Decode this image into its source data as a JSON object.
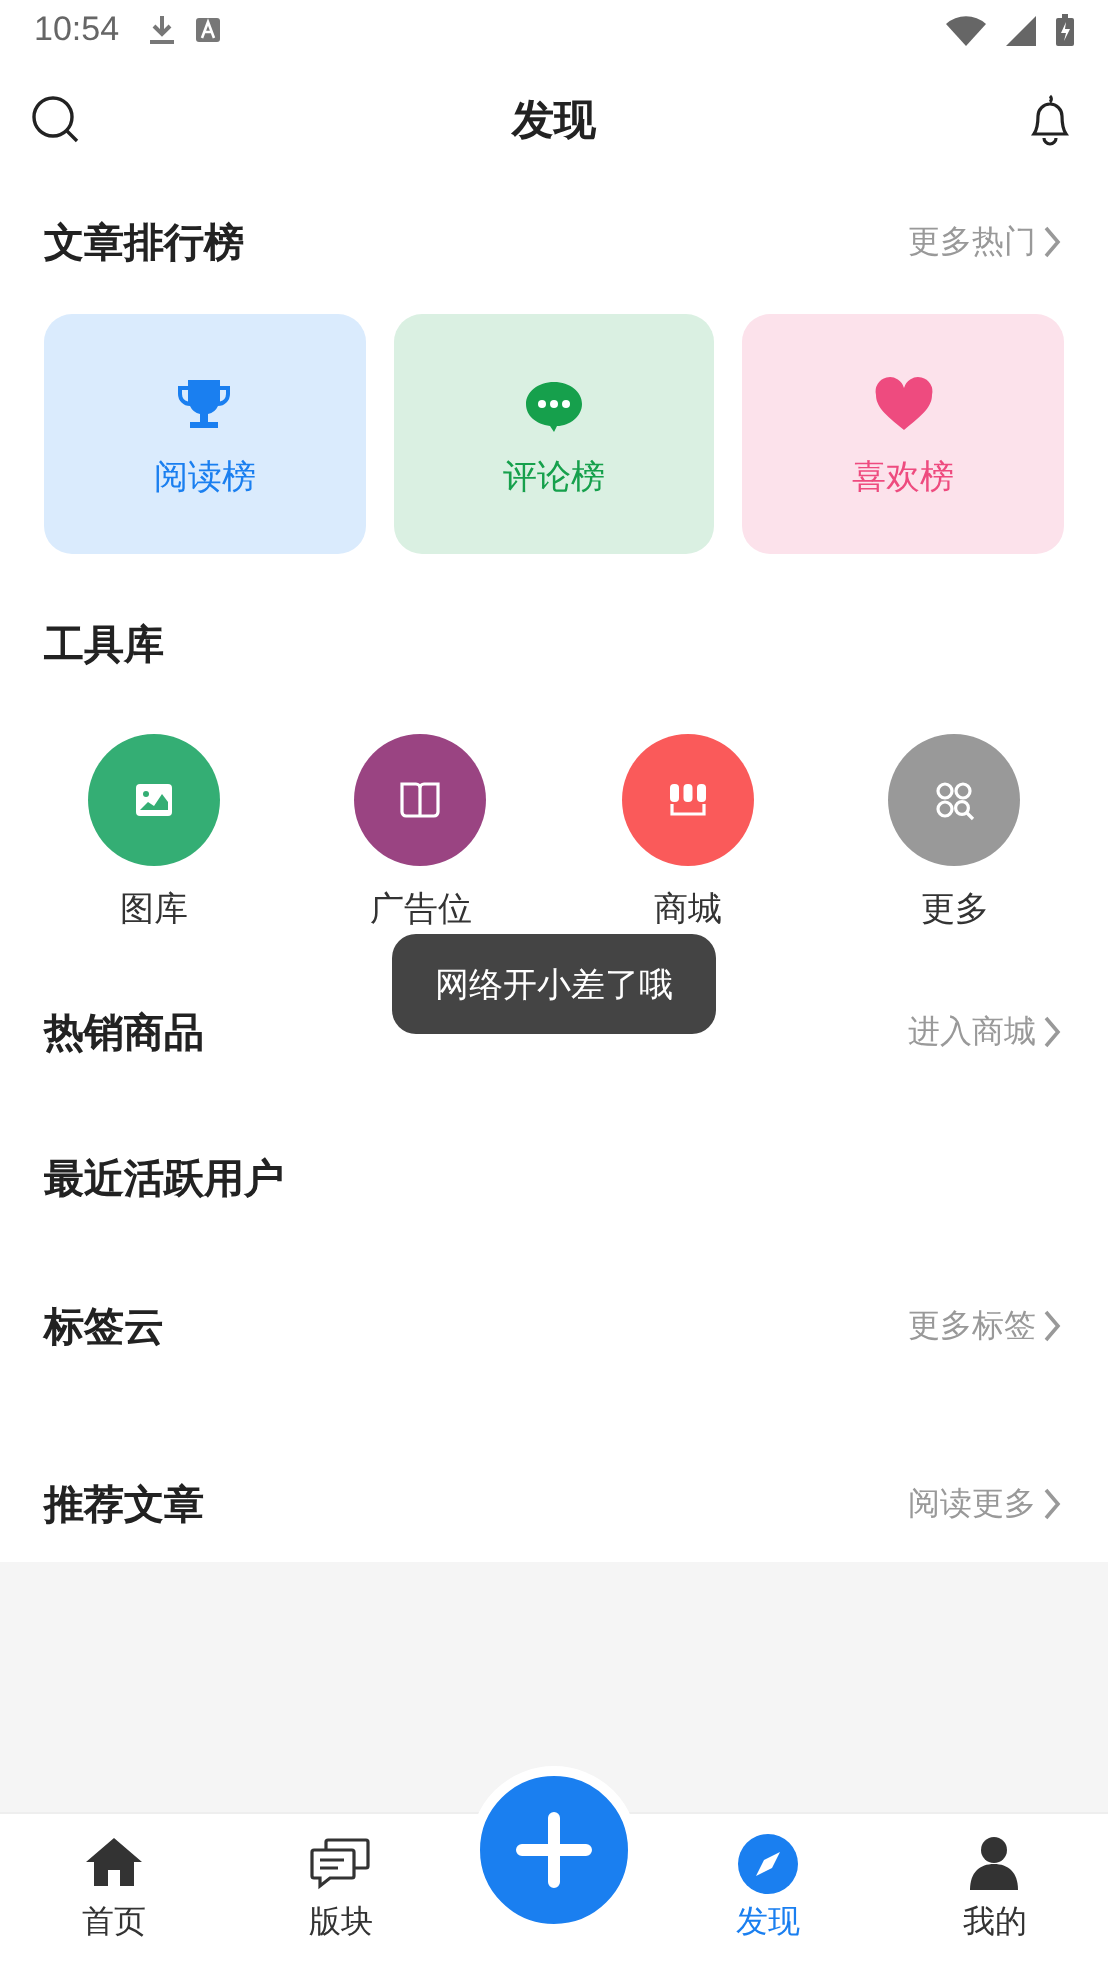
{
  "status_bar": {
    "time": "10:54"
  },
  "header": {
    "title": "发现"
  },
  "sections": [
    {
      "kind": "rank",
      "title": "文章排行榜",
      "more": "更多热门",
      "cards": [
        {
          "label": "阅读榜",
          "color": "#1a7ff0"
        },
        {
          "label": "评论榜",
          "color": "#16a04c"
        },
        {
          "label": "喜欢榜",
          "color": "#ee4b7f"
        }
      ]
    },
    {
      "kind": "tools",
      "title": "工具库",
      "tools": [
        {
          "label": "图库",
          "color": "#34ae74"
        },
        {
          "label": "广告位",
          "color": "#9a4482"
        },
        {
          "label": "商城",
          "color": "#fa5a5a"
        },
        {
          "label": "更多",
          "color": "#999999"
        }
      ]
    },
    {
      "kind": "plain",
      "title": "热销商品",
      "more": "进入商城"
    },
    {
      "kind": "plain",
      "title": "最近活跃用户"
    },
    {
      "kind": "plain",
      "title": "标签云",
      "more": "更多标签"
    },
    {
      "kind": "plain",
      "title": "推荐文章",
      "more": "阅读更多"
    }
  ],
  "toast": {
    "text": "网络开小差了哦"
  },
  "tab_bar": {
    "items": [
      {
        "label": "首页",
        "selected": false
      },
      {
        "label": "版块",
        "selected": false
      },
      {
        "label": "发现",
        "selected": true
      },
      {
        "label": "我的",
        "selected": false
      }
    ]
  }
}
